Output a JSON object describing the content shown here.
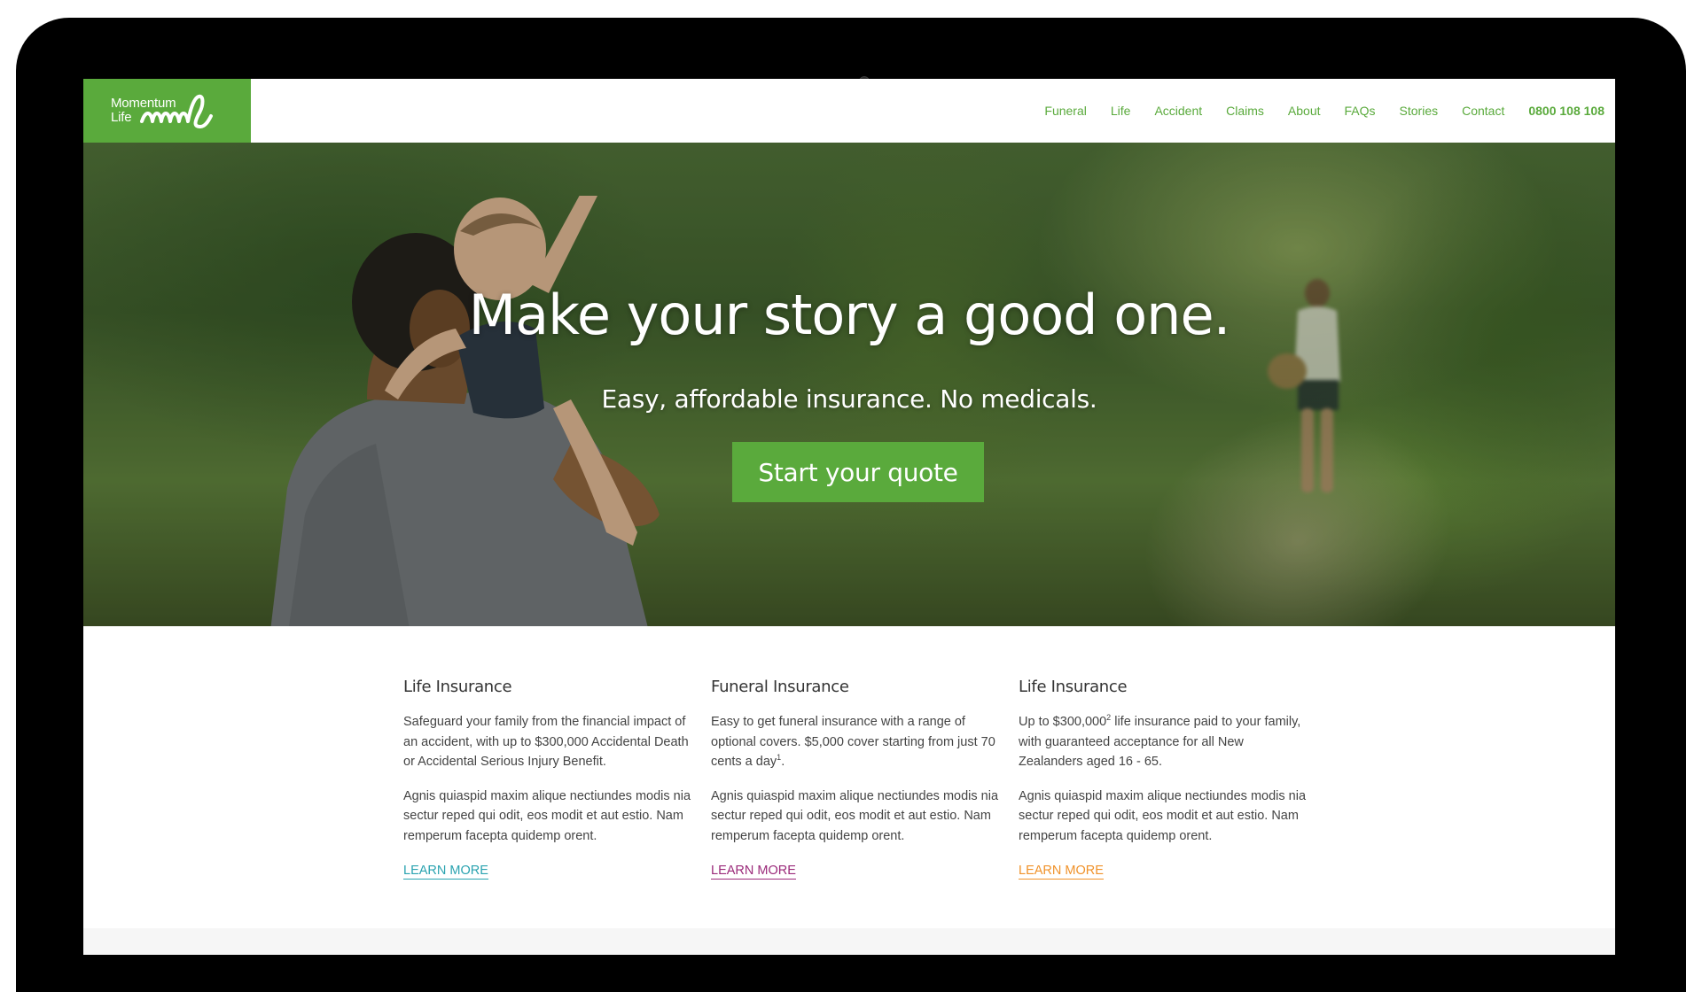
{
  "brand": {
    "name_line1": "Momentum",
    "name_line2": "Life",
    "color": "#5aaa3c"
  },
  "nav": {
    "items": [
      "Funeral",
      "Life",
      "Accident",
      "Claims",
      "About",
      "FAQs",
      "Stories",
      "Contact"
    ],
    "phone": "0800 108 108"
  },
  "hero": {
    "title": "Make your story a good one.",
    "subtitle": "Easy, affordable insurance. No medicals.",
    "cta_label": "Start your quote"
  },
  "products": [
    {
      "title": "Life Insurance",
      "description_a": "Safeguard your family from the financial impact of an accident, with up to $300,000 Accidental Death or Accidental Serious Injury Benefit.",
      "description_b": "",
      "footnote": "",
      "body": "Agnis quiaspid maxim alique nectiundes modis nia sectur reped qui odit, eos modit et aut estio. Nam remperum facepta quidemp orent.",
      "link_label": "LEARN MORE",
      "link_color": "#2aa3b0"
    },
    {
      "title": "Funeral Insurance",
      "description_a": "Easy to get funeral insurance with a range of optional covers. $5,000 cover starting from just 70 cents a day",
      "footnote": "1",
      "description_b": ".",
      "body": "Agnis quiaspid maxim alique nectiundes modis nia sectur reped qui odit, eos modit et aut estio. Nam remperum facepta quidemp orent.",
      "link_label": "LEARN MORE",
      "link_color": "#9b2a7a"
    },
    {
      "title": "Life Insurance",
      "description_a": "Up to $300,000",
      "footnote": "2",
      "description_b": " life insurance paid to your family, with guaranteed acceptance for all New Zealanders aged 16 - 65.",
      "body": "Agnis quiaspid maxim alique nectiundes modis nia sectur reped qui odit, eos modit et aut estio. Nam remperum facepta quidemp orent.",
      "link_label": "LEARN MORE",
      "link_color": "#f0922a"
    }
  ]
}
